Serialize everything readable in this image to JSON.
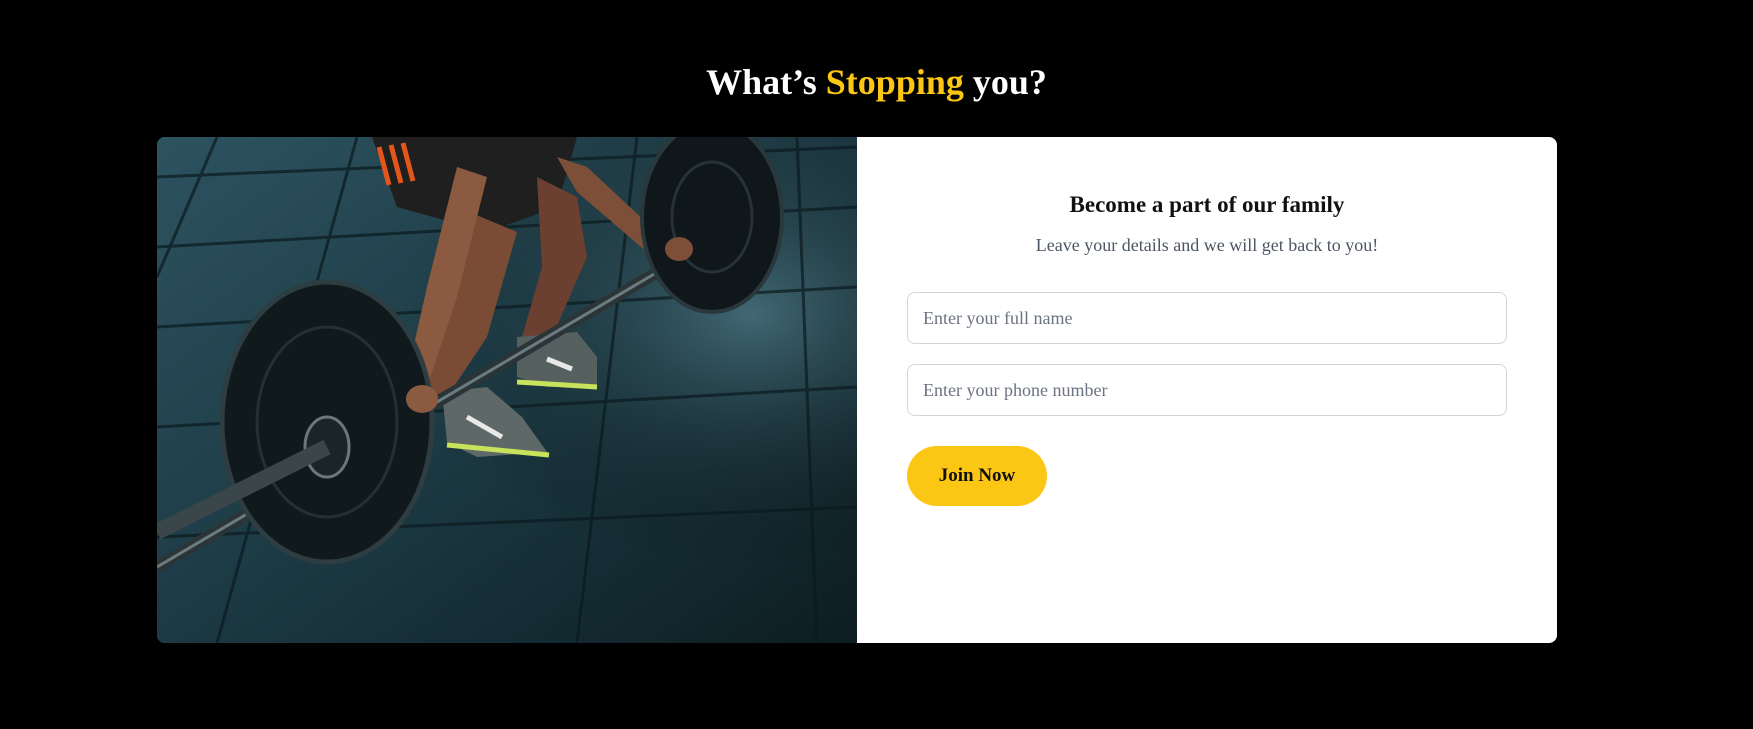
{
  "section": {
    "title_part1": "What’s ",
    "title_accent": "Stopping",
    "title_part2": " you?"
  },
  "form": {
    "title": "Become a part of  our family",
    "subtitle": "Leave your details and we will get back to you!",
    "name_placeholder": "Enter your full name",
    "phone_placeholder": "Enter your phone number",
    "name_value": "",
    "phone_value": "",
    "submit_label": "Join Now"
  },
  "image": {
    "description_icon": "deadlift-barbell-photo"
  },
  "colors": {
    "background": "#000000",
    "accent": "#fcc614",
    "card": "#ffffff",
    "field_border": "#d1d5db",
    "subtitle": "#4b5563"
  }
}
